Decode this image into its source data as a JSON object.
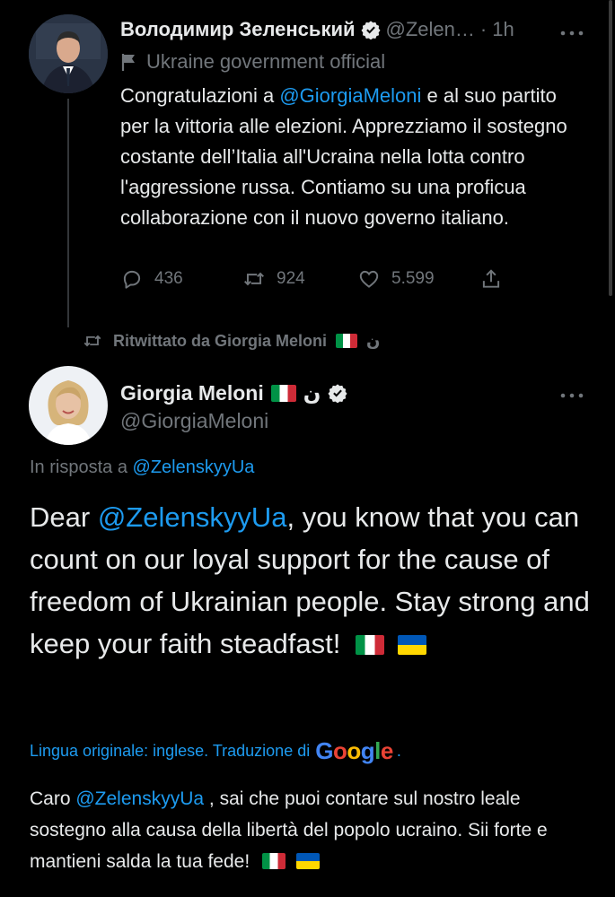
{
  "tweet1": {
    "author_name": "Володимир Зеленський",
    "handle": "@Zelen…",
    "separator": "·",
    "time": "1h",
    "label": "Ukraine government official",
    "text_before": "Congratulazioni a ",
    "mention": "@GiorgiaMeloni",
    "text_after": " e al suo partito per la vittoria alle elezioni. Apprezziamo il sostegno costante dell’Italia all'Ucraina nella lotta contro l'aggressione russa. Contiamo su una proficua collaborazione con il nuovo governo italiano.",
    "replies": "436",
    "retweets": "924",
    "likes": "5.599"
  },
  "retweet_banner": {
    "text": "Ritwittato da Giorgia Meloni",
    "symbol": "ن"
  },
  "tweet2": {
    "author_name": "Giorgia Meloni",
    "symbol": "ن",
    "handle": "@GiorgiaMeloni",
    "reply_prefix": "In risposta a ",
    "reply_to": "@ZelenskyyUa",
    "text_before": "Dear ",
    "mention": "@ZelenskyyUa",
    "text_after": ", you know that you can count on our loyal support for the cause of freedom of Ukrainian people. Stay strong and keep your faith steadfast!",
    "translation_label": "Lingua originale: inglese. Traduzione di ",
    "google": [
      "G",
      "o",
      "o",
      "g",
      "l",
      "e"
    ],
    "translation_dot": ".",
    "translation_before": "Caro ",
    "translation_mention": "@ZelenskyyUa",
    "translation_after": " , sai che puoi contare sul nostro leale sostegno alla causa della libertà del popolo ucraino. Sii forte e mantieni salda la tua fede!"
  },
  "colors": {
    "background": "#000000",
    "text": "#e7e9ea",
    "muted": "#71767b",
    "link": "#1d9bf0",
    "google_blue": "#4285f4",
    "google_red": "#ea4335",
    "google_yellow": "#fbbc05",
    "google_green": "#34a853"
  },
  "icons": [
    "verified-badge-icon",
    "government-flag-icon",
    "more-icon",
    "reply-icon",
    "retweet-icon",
    "like-icon",
    "share-icon"
  ]
}
